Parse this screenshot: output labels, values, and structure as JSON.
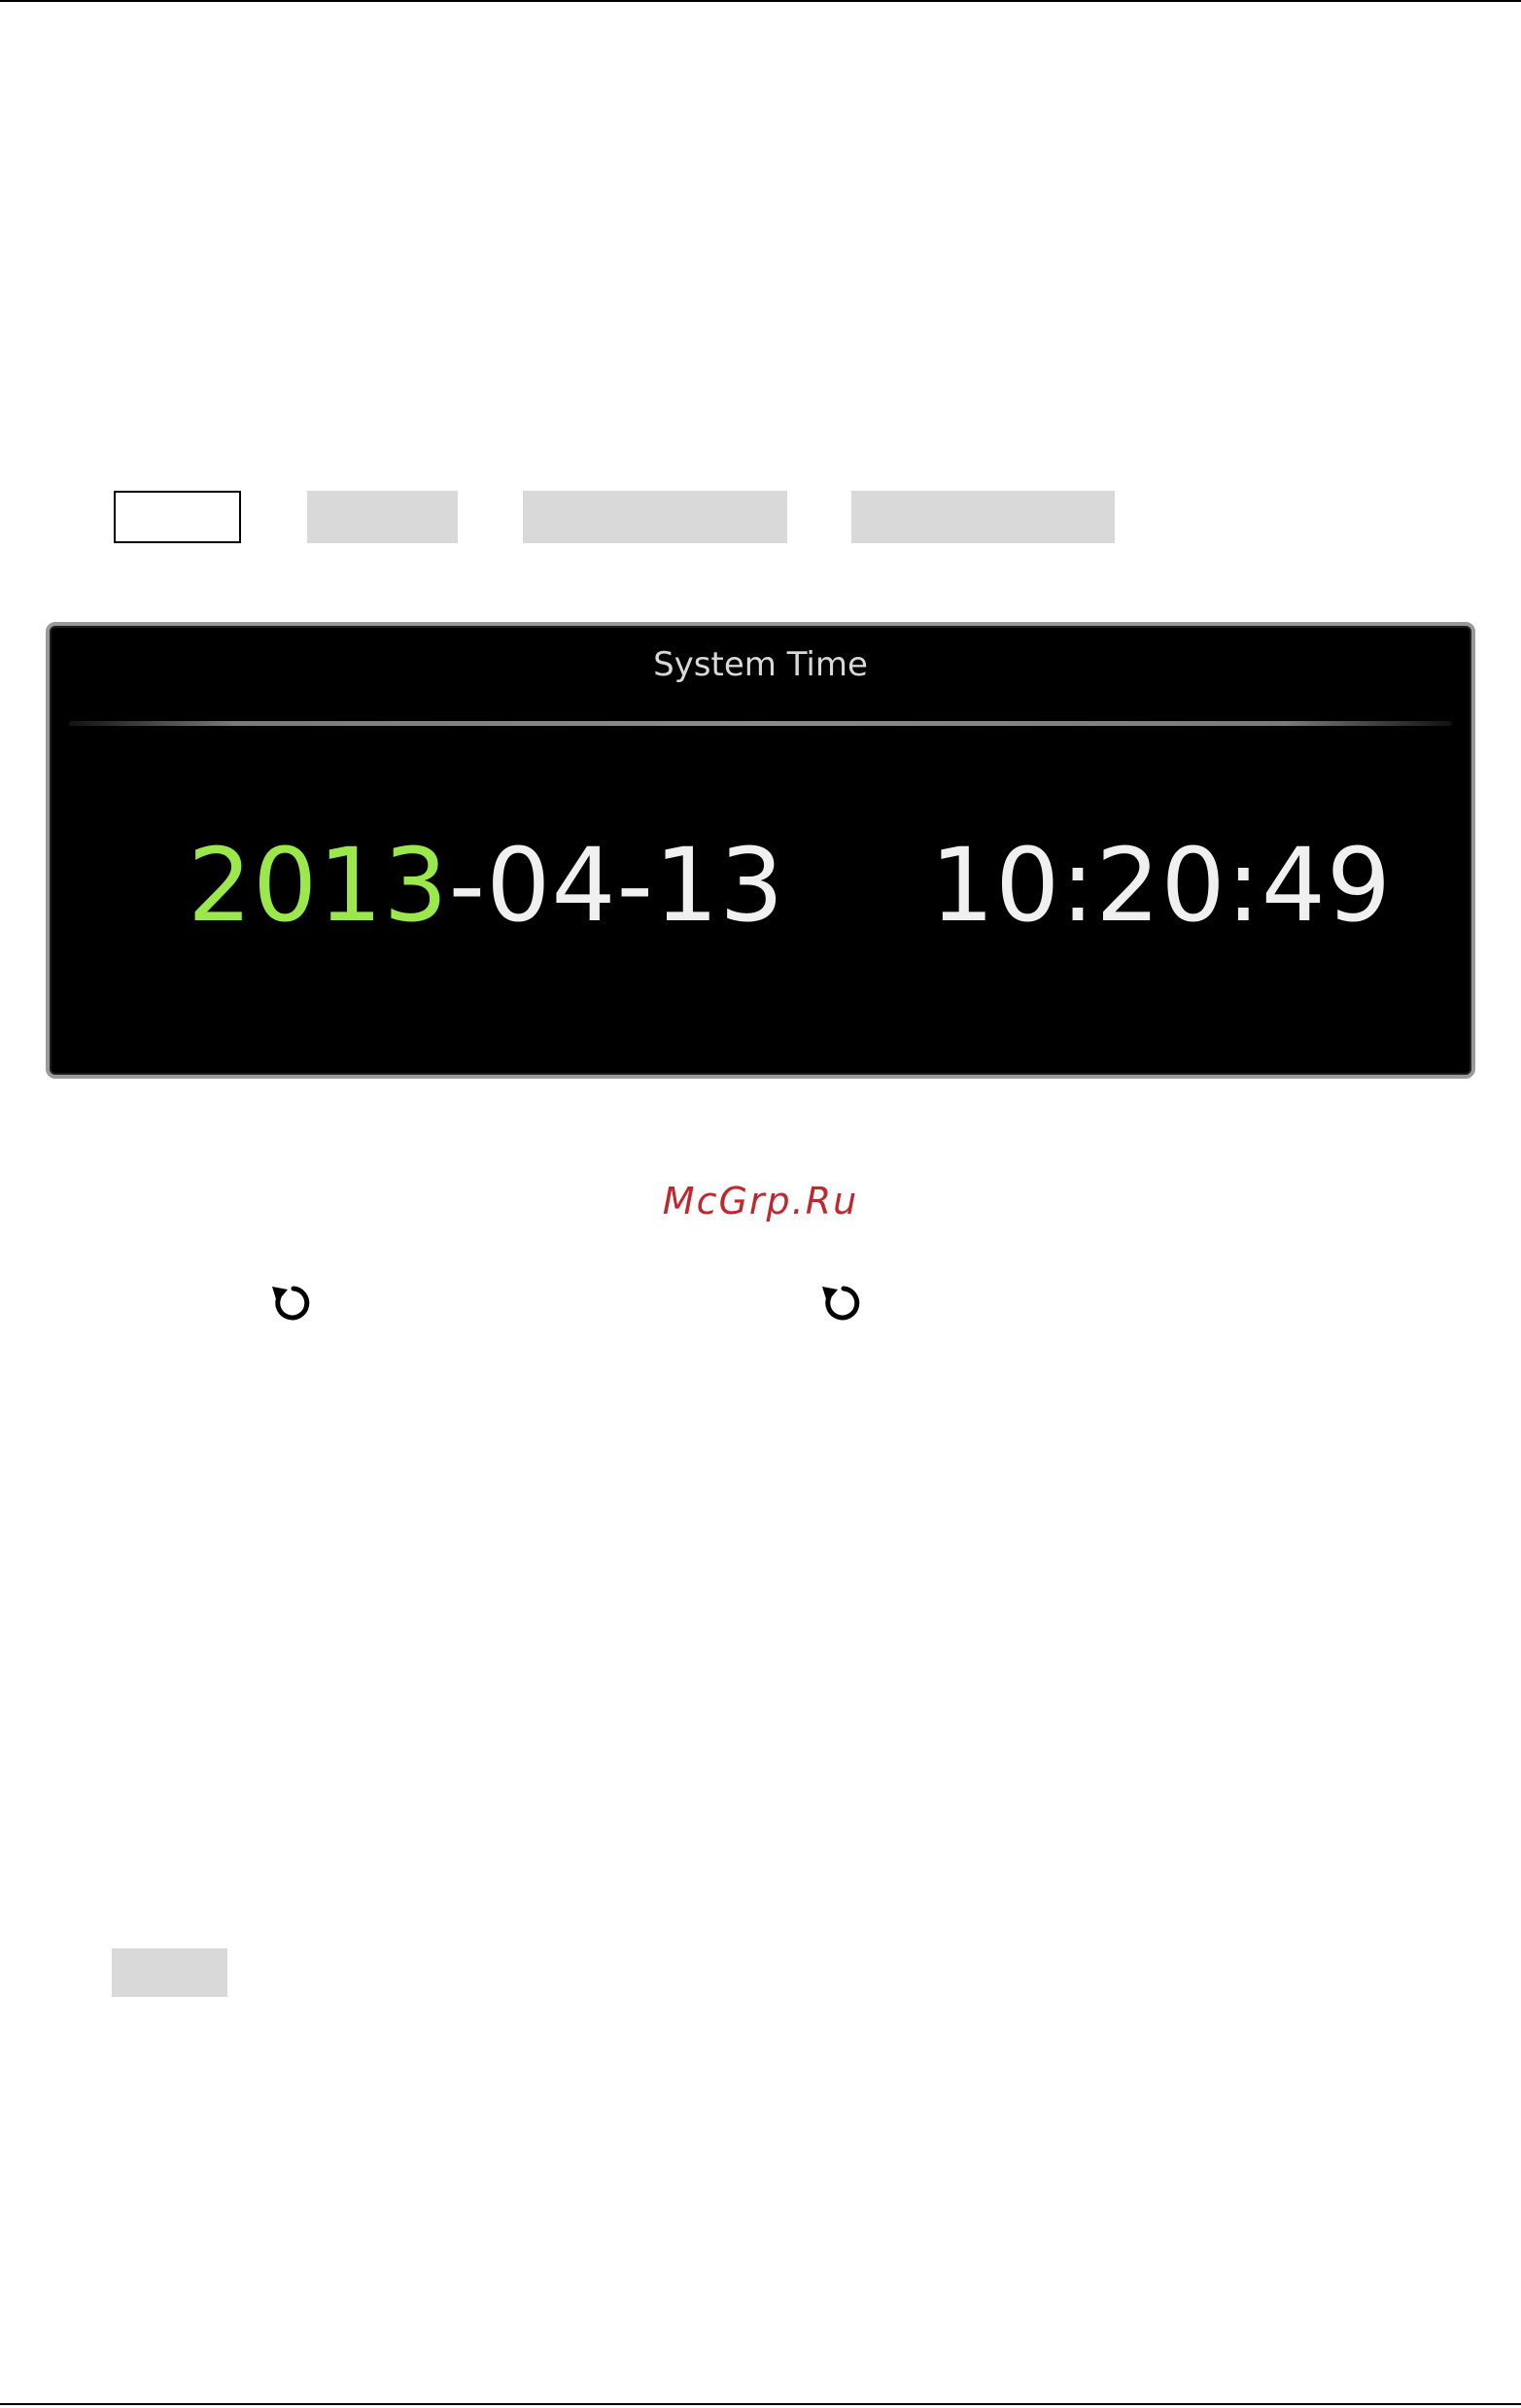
{
  "panel": {
    "title": "System Time",
    "date_year": "2013",
    "date_rest": "-04-13",
    "time": "10:20:49"
  },
  "watermark": "McGrp.Ru",
  "colors": {
    "year_highlight": "#9ae84c",
    "watermark": "#c0282d",
    "panel_background": "#000000",
    "key_gray": "#d9d9d9"
  },
  "icons": {
    "knob": "rotate-knob-icon"
  }
}
